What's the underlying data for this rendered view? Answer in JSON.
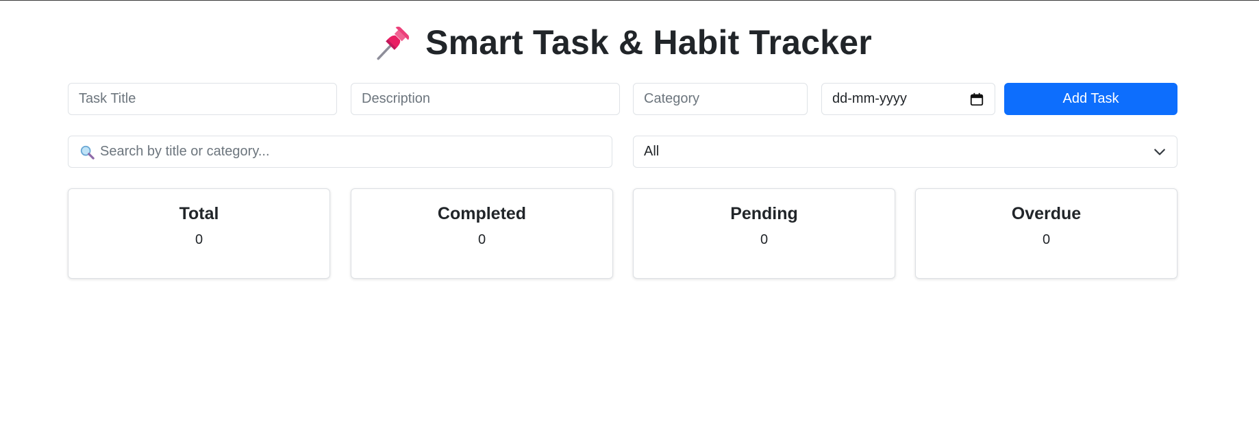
{
  "header": {
    "title": "Smart Task & Habit Tracker",
    "icon": "pushpin-icon"
  },
  "form": {
    "task_title_placeholder": "Task Title",
    "description_placeholder": "Description",
    "category_placeholder": "Category",
    "date_value": "dd-mm-yyyy",
    "add_button_label": "Add Task"
  },
  "filters": {
    "search_placeholder": "Search by title or category...",
    "search_icon": "magnifier-icon",
    "status_selected": "All"
  },
  "stats": [
    {
      "label": "Total",
      "value": "0"
    },
    {
      "label": "Completed",
      "value": "0"
    },
    {
      "label": "Pending",
      "value": "0"
    },
    {
      "label": "Overdue",
      "value": "0"
    }
  ],
  "colors": {
    "primary": "#0d6efd",
    "border": "#dee2e6",
    "text": "#212529",
    "placeholder": "#6c757d"
  }
}
